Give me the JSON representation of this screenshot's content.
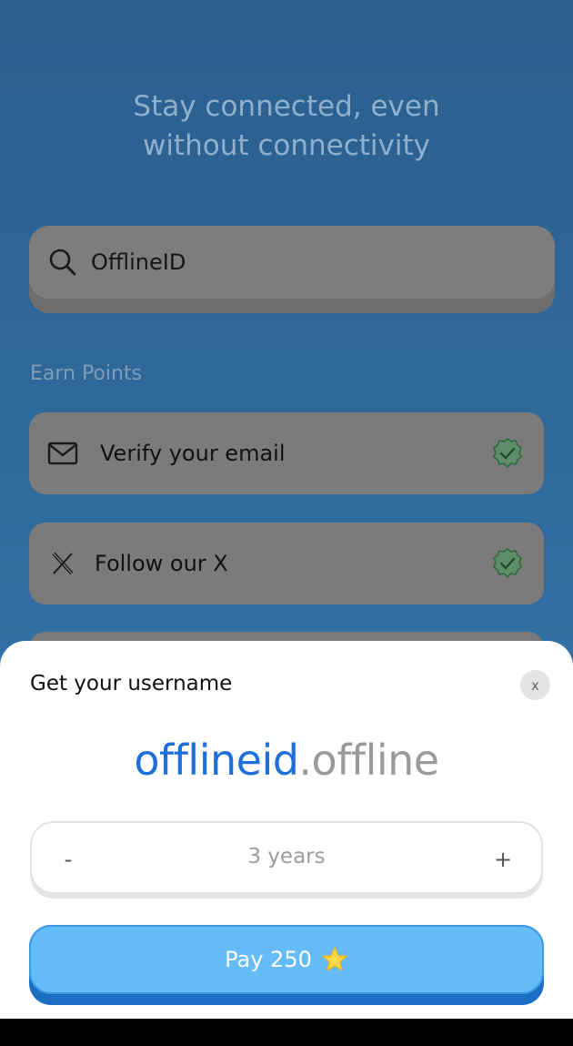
{
  "header": {
    "headline_line1": "Stay connected, even",
    "headline_line2": "without connectivity"
  },
  "search": {
    "icon": "search-icon",
    "value": "OfflineID"
  },
  "earn_points": {
    "title": "Earn Points",
    "tasks": [
      {
        "label": "Verify your email",
        "icon": "mail-icon",
        "completed": true
      },
      {
        "label": "Follow our X",
        "icon": "x-logo-icon",
        "completed": true
      }
    ]
  },
  "sheet": {
    "title": "Get your username",
    "close_label": "x",
    "username_name": "offlineid",
    "username_tld": ".offline",
    "stepper": {
      "minus_label": "-",
      "value": "3 years",
      "plus_label": "+"
    },
    "pay_label": "Pay 250",
    "pay_icon": "star-icon"
  },
  "colors": {
    "background": "#2f6a9c",
    "name_accent": "#1e6fd9",
    "pay_button": "#65bcf7",
    "check_green": "#2e8b47"
  }
}
